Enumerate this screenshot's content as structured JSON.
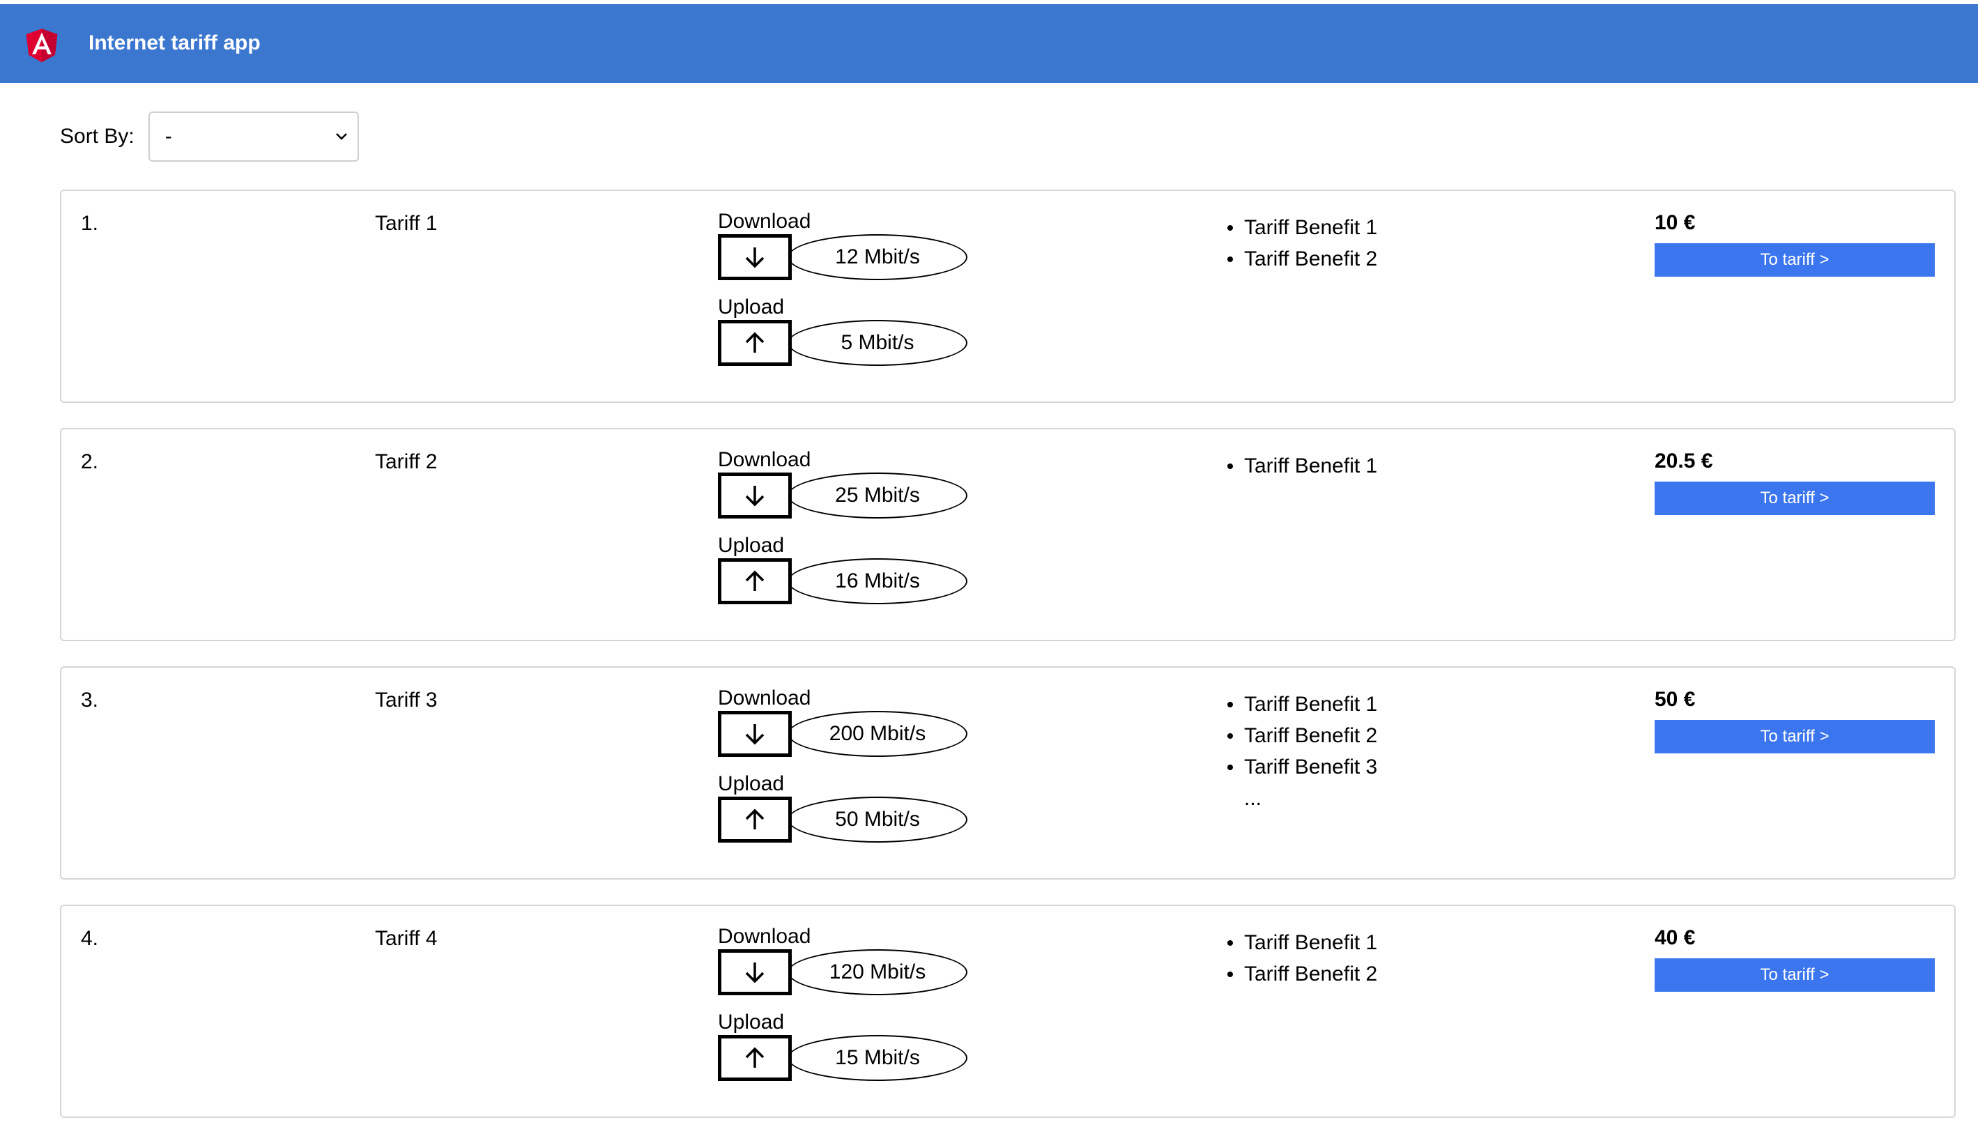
{
  "app": {
    "title": "Internet tariff app"
  },
  "sort": {
    "label": "Sort By:",
    "selected": "-"
  },
  "speed_labels": {
    "download": "Download",
    "upload": "Upload"
  },
  "button_label": "To tariff >",
  "tariffs": [
    {
      "rank": "1.",
      "name": "Tariff 1",
      "download": "12 Mbit/s",
      "upload": "5 Mbit/s",
      "benefits": [
        "Tariff Benefit 1",
        "Tariff Benefit 2"
      ],
      "more": "",
      "price": "10 €"
    },
    {
      "rank": "2.",
      "name": "Tariff 2",
      "download": "25 Mbit/s",
      "upload": "16 Mbit/s",
      "benefits": [
        "Tariff Benefit 1"
      ],
      "more": "",
      "price": "20.5 €"
    },
    {
      "rank": "3.",
      "name": "Tariff 3",
      "download": "200 Mbit/s",
      "upload": "50 Mbit/s",
      "benefits": [
        "Tariff Benefit 1",
        "Tariff Benefit 2",
        "Tariff Benefit 3"
      ],
      "more": "...",
      "price": "50 €"
    },
    {
      "rank": "4.",
      "name": "Tariff 4",
      "download": "120 Mbit/s",
      "upload": "15 Mbit/s",
      "benefits": [
        "Tariff Benefit 1",
        "Tariff Benefit 2"
      ],
      "more": "",
      "price": "40 €"
    }
  ],
  "colors": {
    "header": "#3b76cf",
    "button": "#3b76ee",
    "logo": "#dd0031"
  },
  "icons": {
    "logo": "angular-logo-icon",
    "select": "chevron-down-icon",
    "download": "arrow-down-icon",
    "upload": "arrow-up-icon"
  }
}
